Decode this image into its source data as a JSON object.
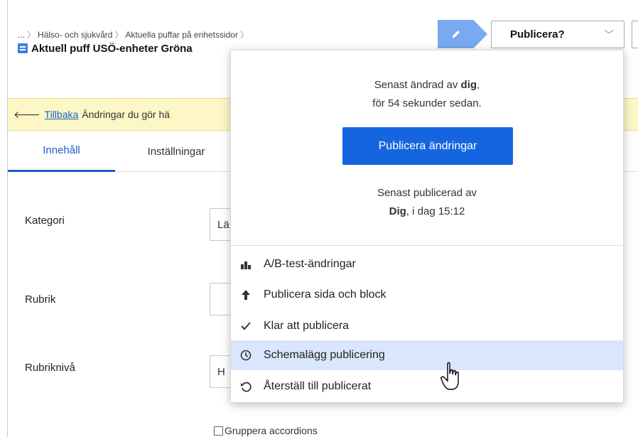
{
  "breadcrumb": {
    "items": [
      "...",
      "Hälso- och sjukvård",
      "Aktuella puffar på enhetssidor"
    ],
    "trailing": ""
  },
  "page_title": "Aktuell puff USÖ-enheter Gröna",
  "toolbar": {
    "publish_label": "Publicera?"
  },
  "notice": {
    "back_link": "Tillbaka",
    "text": "Ändringar du gör hä"
  },
  "tabs": [
    {
      "label": "Innehåll"
    },
    {
      "label": "Inställningar"
    }
  ],
  "form": {
    "kategori_label": "Kategori",
    "kategori_value": "Lä",
    "rubrik_label": "Rubrik",
    "rubrik_value": "",
    "rubrikniva_label": "Rubriknivå",
    "rubrikniva_value": "H",
    "group_accordions_label": "Gruppera accordions"
  },
  "dropdown": {
    "changed_line1": "Senast ändrad av",
    "changed_by": "dig",
    "changed_line2": "för 54 sekunder sedan.",
    "publish_changes_label": "Publicera ändringar",
    "published_line1": "Senast publicerad av",
    "published_by": "Dig",
    "published_when": ", i dag 15:12",
    "items": [
      {
        "label": "A/B-test-ändringar",
        "icon": "bar-chart-icon"
      },
      {
        "label": "Publicera sida och block",
        "icon": "arrow-up-icon"
      },
      {
        "label": "Klar att publicera",
        "icon": "checkmark-icon"
      },
      {
        "label": "Schemalägg publicering",
        "icon": "clock-icon"
      },
      {
        "label": "Återställ till publicerat",
        "icon": "revert-icon"
      }
    ]
  },
  "colors": {
    "accent": "#1565e0",
    "highlight": "#d9e6fb",
    "notice_bg": "#fdf7c6",
    "edit_chevron": "#79a9ef"
  }
}
